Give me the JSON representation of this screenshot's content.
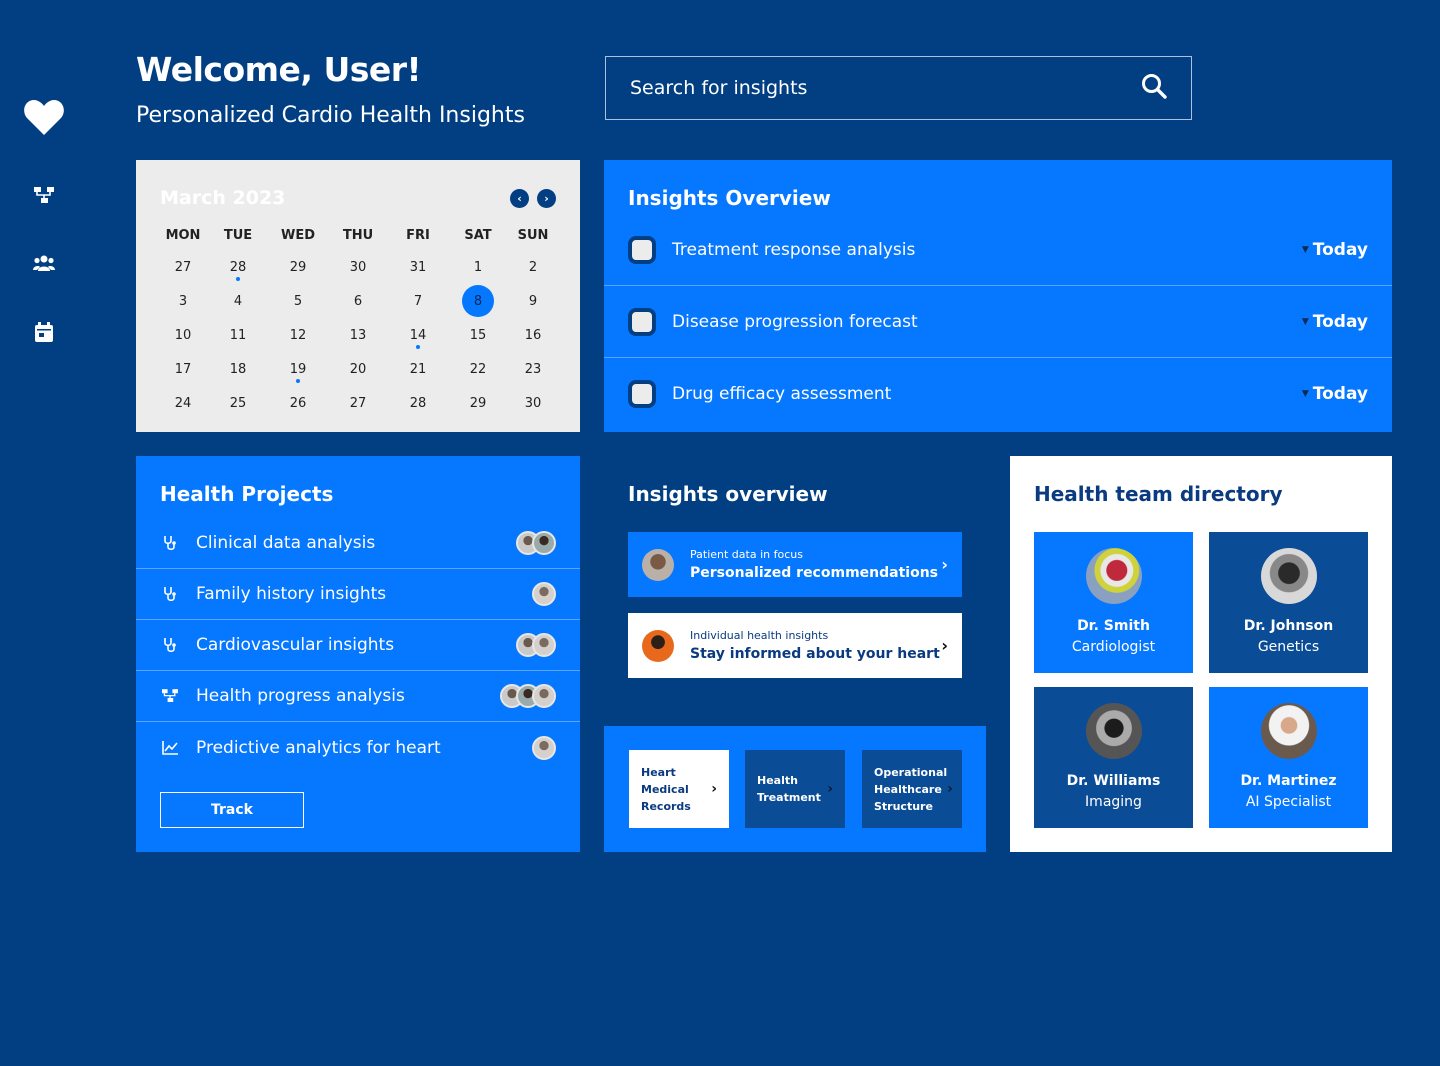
{
  "header": {
    "welcome": "Welcome, User!",
    "subtitle": "Personalized Cardio Health Insights"
  },
  "search": {
    "placeholder": "Search for insights",
    "icon": "search-icon"
  },
  "sidebar": {
    "icons": [
      "heart-icon",
      "hierarchy-icon",
      "team-icon",
      "calendar-icon"
    ]
  },
  "calendar": {
    "month": "March 2023",
    "weekdays": [
      "MON",
      "TUE",
      "WED",
      "THU",
      "FRI",
      "SAT",
      "SUN"
    ],
    "weeks": [
      [
        "27",
        "28",
        "29",
        "30",
        "31",
        "1",
        "2"
      ],
      [
        "3",
        "4",
        "5",
        "6",
        "7",
        "8",
        "9"
      ],
      [
        "10",
        "11",
        "12",
        "13",
        "14",
        "15",
        "16"
      ],
      [
        "17",
        "18",
        "19",
        "20",
        "21",
        "22",
        "23"
      ],
      [
        "24",
        "25",
        "26",
        "27",
        "28",
        "29",
        "30"
      ]
    ],
    "selected_day": "8",
    "event_markers": [
      "28",
      "14",
      "19"
    ]
  },
  "insights_overview": {
    "title": "Insights Overview",
    "items": [
      {
        "label": "Treatment response analysis",
        "due": "Today"
      },
      {
        "label": "Disease progression forecast",
        "due": "Today"
      },
      {
        "label": "Drug efficacy assessment",
        "due": "Today"
      }
    ]
  },
  "projects": {
    "title": "Health Projects",
    "items": [
      {
        "label": "Clinical data analysis",
        "icon": "stethoscope-icon"
      },
      {
        "label": "Family history insights",
        "icon": "stethoscope-icon"
      },
      {
        "label": "Cardiovascular insights",
        "icon": "stethoscope-icon"
      },
      {
        "label": "Health progress analysis",
        "icon": "hierarchy-icon"
      },
      {
        "label": "Predictive analytics for heart",
        "icon": "line-chart-icon"
      }
    ],
    "button": "Track"
  },
  "overview_cards": {
    "title": "Insights overview",
    "cards": [
      {
        "small": "Patient data in focus",
        "big": "Personalized recommendations"
      },
      {
        "small": "Individual health insights",
        "big": "Stay informed about your heart"
      }
    ]
  },
  "documents": [
    {
      "label": "Heart Medical Records"
    },
    {
      "label": "Health Treatment"
    },
    {
      "label": "Operational Healthcare Structure"
    }
  ],
  "team": {
    "title": "Health team directory",
    "members": [
      {
        "name": "Dr. Smith",
        "role": "Cardiologist"
      },
      {
        "name": "Dr. Johnson",
        "role": "Genetics"
      },
      {
        "name": "Dr. Williams",
        "role": "Imaging"
      },
      {
        "name": "Dr. Martinez",
        "role": "AI Specialist"
      }
    ]
  },
  "colors": {
    "background": "#023f82",
    "accent": "#0677ff",
    "navy_tile": "#0a4c96",
    "calendar_bg": "#ececec"
  }
}
